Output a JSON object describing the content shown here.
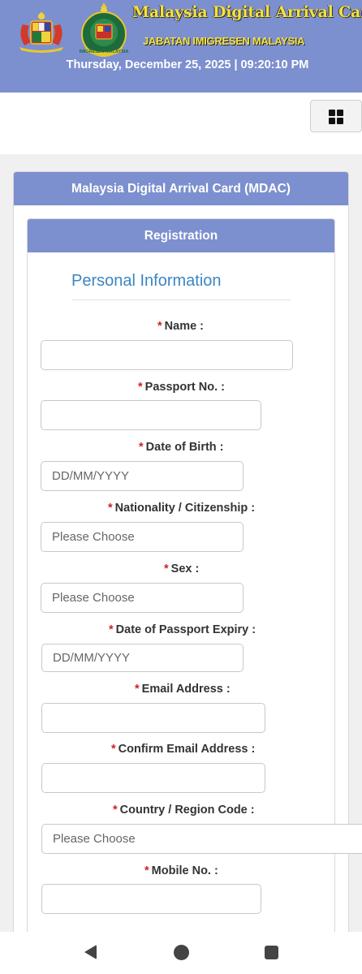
{
  "header": {
    "title": "Malaysia Digital Arrival Card",
    "subtitle": "JABATAN IMIGRESEN MALAYSIA",
    "datetime": "Thursday, December 25, 2025 | 09:20:10 PM",
    "crest_icon": "malaysia-coat-of-arms-icon",
    "badge_icon": "immigration-emblem-icon",
    "badge_text": "IMIGRESEN MALAYSIA"
  },
  "toolbar": {
    "menu_icon": "grid-menu-icon"
  },
  "card": {
    "title": "Malaysia Digital Arrival Card (MDAC)",
    "registration_title": "Registration",
    "section_title": "Personal Information"
  },
  "form": {
    "required_mark": "*",
    "name_label": "Name :",
    "passport_label": "Passport No. :",
    "dob_label": "Date of Birth :",
    "dob_placeholder": "DD/MM/YYYY",
    "nationality_label": "Nationality / Citizenship :",
    "nationality_value": "Please Choose",
    "sex_label": "Sex :",
    "sex_value": "Please Choose",
    "expiry_label": "Date of Passport Expiry :",
    "expiry_placeholder": "DD/MM/YYYY",
    "email_label": "Email Address :",
    "confirm_email_label": "Confirm Email Address :",
    "country_code_label": "Country / Region Code :",
    "country_code_value": "Please Choose",
    "mobile_label": "Mobile No. :"
  },
  "navbar": {
    "back_icon": "back-triangle-icon",
    "home_icon": "home-circle-icon",
    "recent_icon": "recent-apps-square-icon"
  },
  "colors": {
    "accent": "#7c8fcf",
    "title_yellow": "#f5e23a",
    "section_blue": "#3a86c4",
    "required_red": "#d21f1f"
  }
}
